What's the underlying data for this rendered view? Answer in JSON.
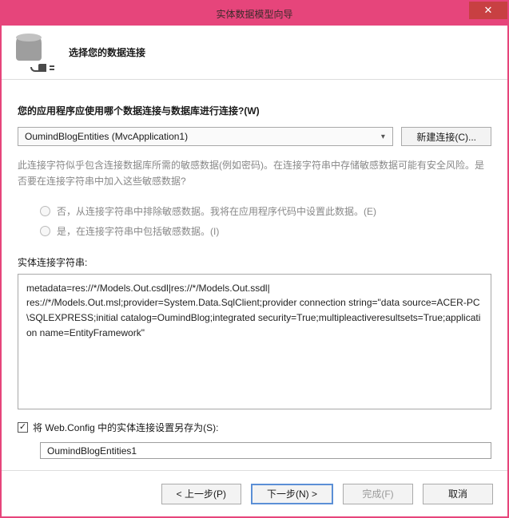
{
  "window": {
    "title": "实体数据模型向导"
  },
  "header": {
    "title": "选择您的数据连接"
  },
  "main": {
    "prompt": "您的应用程序应使用哪个数据连接与数据库进行连接?(W)",
    "connection_selected": "OumindBlogEntities (MvcApplication1)",
    "new_connection_btn": "新建连接(C)...",
    "info_text": "此连接字符似乎包含连接数据库所需的敏感数据(例如密码)。在连接字符串中存储敏感数据可能有安全风险。是否要在连接字符串中加入这些敏感数据?",
    "radio_exclude": "否，从连接字符串中排除敏感数据。我将在应用程序代码中设置此数据。(E)",
    "radio_include": "是，在连接字符串中包括敏感数据。(I)",
    "conn_label": "实体连接字符串:",
    "conn_string": "metadata=res://*/Models.Out.csdl|res://*/Models.Out.ssdl|\nres://*/Models.Out.msl;provider=System.Data.SqlClient;provider connection string=\"data source=ACER-PC\\SQLEXPRESS;initial catalog=OumindBlog;integrated security=True;multipleactiveresultsets=True;application name=EntityFramework\"",
    "save_checkbox_label": "将 Web.Config 中的实体连接设置另存为(S):",
    "save_checkbox_checked": true,
    "save_name": "OumindBlogEntities1"
  },
  "footer": {
    "prev": "< 上一步(P)",
    "next": "下一步(N) >",
    "finish": "完成(F)",
    "cancel": "取消"
  }
}
